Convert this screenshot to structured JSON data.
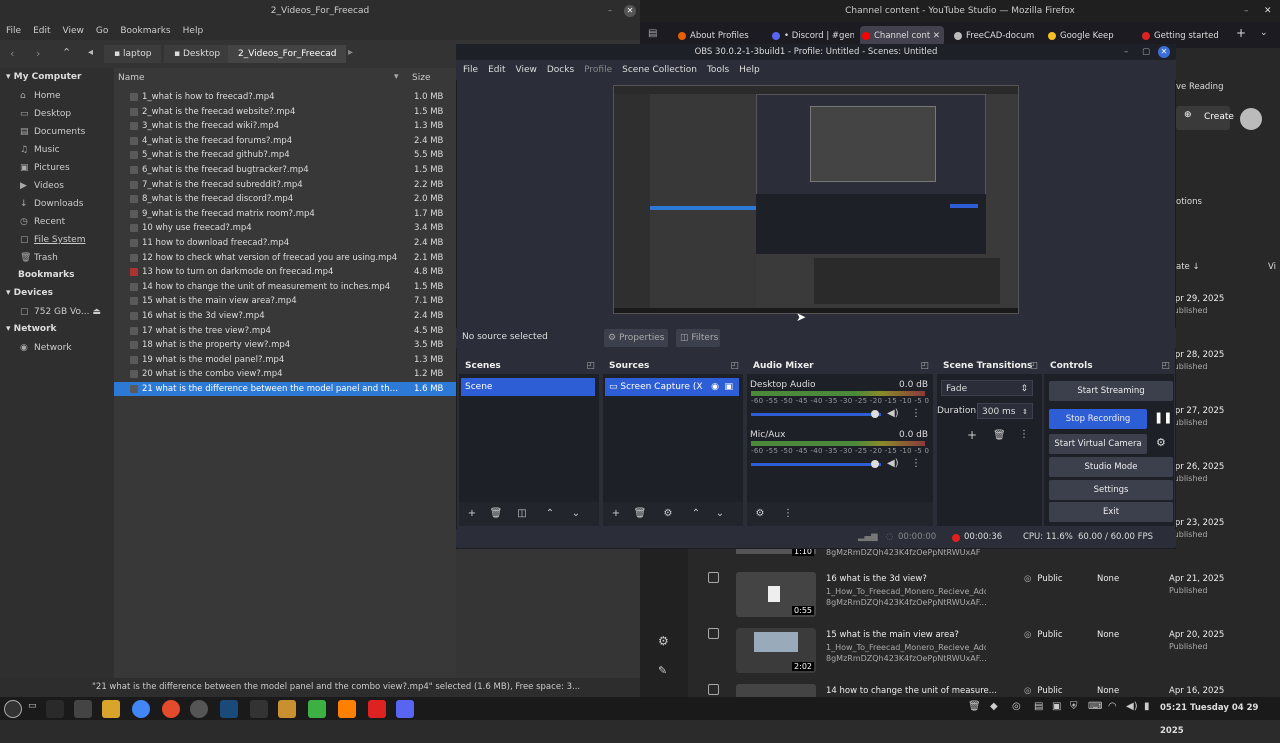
{
  "file_manager": {
    "window_title": "2_Videos_For_Freecad",
    "menu": [
      "File",
      "Edit",
      "View",
      "Go",
      "Bookmarks",
      "Help"
    ],
    "breadcrumbs": [
      "laptop",
      "Desktop",
      "2_Videos_For_Freecad"
    ],
    "columns": {
      "name": "Name",
      "size": "Size"
    },
    "sidebar": {
      "my_computer": "My Computer",
      "places": [
        "Home",
        "Desktop",
        "Documents",
        "Music",
        "Pictures",
        "Videos",
        "Downloads",
        "Recent",
        "File System",
        "Trash"
      ],
      "bookmarks": "Bookmarks",
      "devices": "Devices",
      "device_item": "752 GB Vo...",
      "network_head": "Network",
      "network_item": "Network"
    },
    "files": [
      {
        "name": "1_what is how to freecad?.mp4",
        "size": "1.0 MB"
      },
      {
        "name": "2_what is the freecad website?.mp4",
        "size": "1.5 MB"
      },
      {
        "name": "3_what is the freecad wiki?.mp4",
        "size": "1.3 MB"
      },
      {
        "name": "4_what is the freecad forums?.mp4",
        "size": "2.4 MB"
      },
      {
        "name": "5_what is the freecad github?.mp4",
        "size": "5.5 MB"
      },
      {
        "name": "6_what is the freecad bugtracker?.mp4",
        "size": "1.5 MB"
      },
      {
        "name": "7_what is the freecad subreddit?.mp4",
        "size": "2.2 MB"
      },
      {
        "name": "8_what is the freecad discord?.mp4",
        "size": "2.0 MB"
      },
      {
        "name": "9_what is the freecad matrix room?.mp4",
        "size": "1.7 MB"
      },
      {
        "name": "10 why use freecad?.mp4",
        "size": "3.4 MB"
      },
      {
        "name": "11 how to download freecad?.mp4",
        "size": "2.4 MB"
      },
      {
        "name": "12 how to check what version of freecad you are using.mp4",
        "size": "2.1 MB"
      },
      {
        "name": "13 how to turn on darkmode on freecad.mp4",
        "size": "4.8 MB"
      },
      {
        "name": "14 how to change the unit of measurement to inches.mp4",
        "size": "1.5 MB"
      },
      {
        "name": "15 what is the main view area?.mp4",
        "size": "7.1 MB"
      },
      {
        "name": "16 what is the 3d view?.mp4",
        "size": "2.4 MB"
      },
      {
        "name": "17 what is the tree view?.mp4",
        "size": "4.5 MB"
      },
      {
        "name": "18 what is the property view?.mp4",
        "size": "3.5 MB"
      },
      {
        "name": "19 what is the model panel?.mp4",
        "size": "1.3 MB"
      },
      {
        "name": "20 what is the combo view?.mp4",
        "size": "1.2 MB"
      },
      {
        "name": "21 what is the difference between the model panel and the co...",
        "size": "1.6 MB"
      }
    ],
    "status": "\"21 what is the difference between the model panel and the combo view?.mp4\" selected (1.6 MB), Free space: 3..."
  },
  "firefox": {
    "window_title": "Channel content - YouTube Studio — Mozilla Firefox",
    "tabs": [
      {
        "label": "About Profiles",
        "color": "#e66000"
      },
      {
        "label": "• Discord | #gen",
        "color": "#5865f2"
      },
      {
        "label": "Channel cont",
        "color": "#ff0000"
      },
      {
        "label": "FreeCAD-docum",
        "color": "#bbbbbb"
      },
      {
        "label": "Google Keep",
        "color": "#f6bf26"
      },
      {
        "label": "Getting started",
        "color": "#d22"
      }
    ]
  },
  "youtube": {
    "create": "Create",
    "reading": "ve Reading",
    "options": "otions",
    "sort": "ate ↓",
    "vi": "Vi",
    "dates_top": [
      "Apr 29, 2025",
      "Apr 28, 2025",
      "Apr 27, 2025",
      "Apr 26, 2025",
      "Apr 23, 2025"
    ],
    "published": "Published",
    "rows": [
      {
        "title": "16 what is the 3d view?",
        "desc1": "1_How_To_Freecad_Monero_Recieve_Addi",
        "desc2": "8gMzRmDZQh423K4fzOePpNtRWUxAF...",
        "dur": "0:55",
        "vis": "Public",
        "restr": "None",
        "date": "Apr 21, 2025",
        "status": "Published"
      },
      {
        "title": "15 what is the main view area?",
        "desc1": "1_How_To_Freecad_Monero_Recieve_Addi",
        "desc2": "8gMzRmDZQh423K4fzOePpNtRWUxAF...",
        "dur": "2:02",
        "vis": "Public",
        "restr": "None",
        "date": "Apr 20, 2025",
        "status": "Published"
      },
      {
        "title": "14 how to change the unit of measure...",
        "desc1": "",
        "desc2": "",
        "dur": "",
        "vis": "Public",
        "restr": "None",
        "date": "Apr 16, 2025",
        "status": ""
      }
    ],
    "partial_desc": "8gMzRmDZQh423K4fzOePpNtRWUxAF",
    "partial_dur": "1:10"
  },
  "obs": {
    "window_title": "OBS 30.0.2-1-3build1 - Profile: Untitled - Scenes: Untitled",
    "menu": [
      "File",
      "Edit",
      "View",
      "Docks",
      "Profile",
      "Scene Collection",
      "Tools",
      "Help"
    ],
    "no_source": "No source selected",
    "properties": "Properties",
    "filters": "Filters",
    "scenes": {
      "title": "Scenes",
      "items": [
        "Scene"
      ]
    },
    "sources": {
      "title": "Sources",
      "items": [
        "Screen Capture (X"
      ]
    },
    "mixer": {
      "title": "Audio Mixer",
      "channels": [
        {
          "name": "Desktop Audio",
          "db": "0.0 dB"
        },
        {
          "name": "Mic/Aux",
          "db": "0.0 dB"
        }
      ],
      "scale": "-60 -55 -50 -45 -40 -35 -30 -25 -20 -15 -10 -5 0"
    },
    "transitions": {
      "title": "Scene Transitions",
      "selected": "Fade",
      "duration_label": "Duration",
      "duration_value": "300 ms"
    },
    "controls": {
      "title": "Controls",
      "start_streaming": "Start Streaming",
      "stop_recording": "Stop Recording",
      "start_virtual_camera": "Start Virtual Camera",
      "studio_mode": "Studio Mode",
      "settings": "Settings",
      "exit": "Exit"
    },
    "status": {
      "stream_time": "00:00:00",
      "rec_time": "00:00:36",
      "cpu": "CPU: 11.6%",
      "fps": "60.00 / 60.00 FPS"
    }
  },
  "taskbar": {
    "clock": "05:21 Tuesday 04 29 2025"
  }
}
